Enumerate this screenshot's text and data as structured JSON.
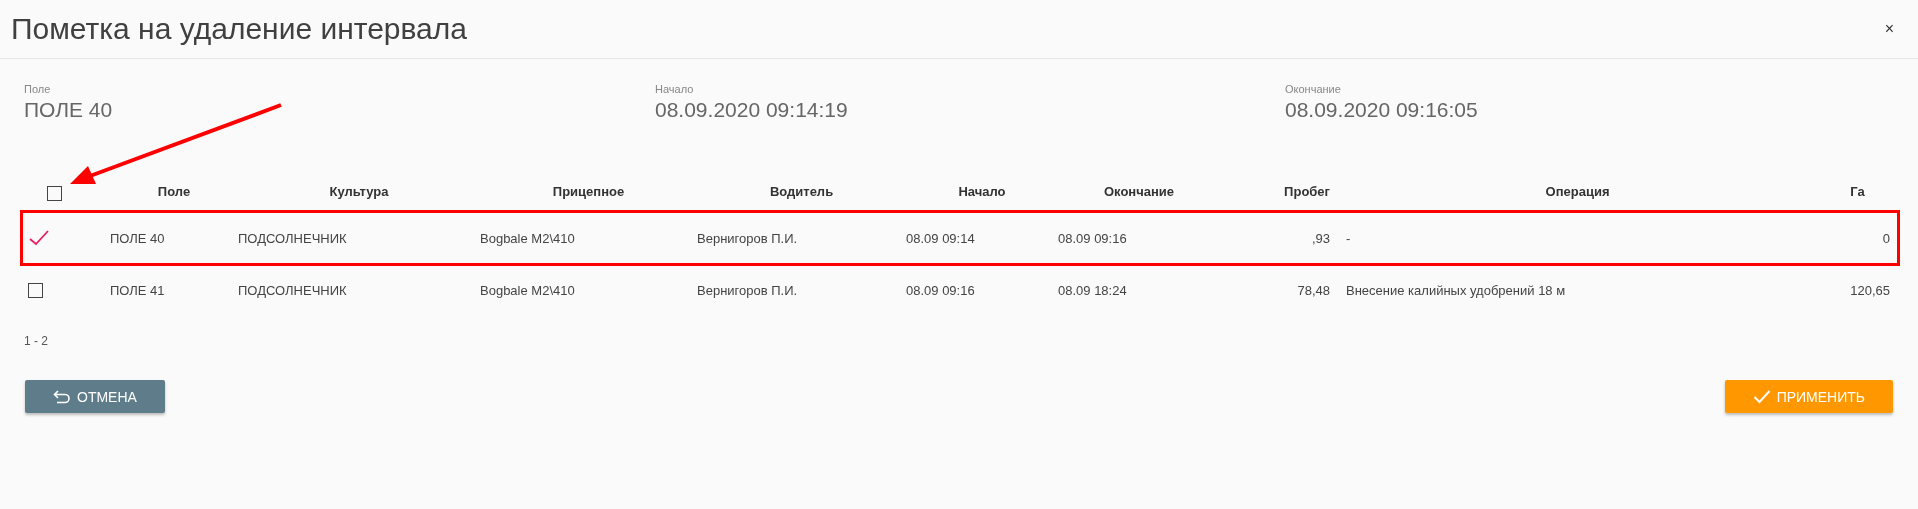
{
  "window": {
    "title": "Пометка на удаление интервала",
    "close": "×"
  },
  "fields": [
    {
      "label": "Поле",
      "value": "ПОЛЕ 40"
    },
    {
      "label": "Начало",
      "value": "08.09.2020 09:14:19"
    },
    {
      "label": "Окончание",
      "value": "08.09.2020 09:16:05"
    }
  ],
  "table": {
    "select_all_checked": false,
    "columns": [
      "Поле",
      "Культура",
      "Прицепное",
      "Водитель",
      "Начало",
      "Окончание",
      "Пробег",
      "Операция",
      "Га"
    ],
    "rows": [
      {
        "checked": true,
        "highlighted": true,
        "cells": [
          "ПОЛЕ 40",
          "ПОДСОЛНЕЧНИК",
          "Bogbale M2\\410",
          "Вернигоров П.И.",
          "08.09 09:14",
          "08.09 09:16",
          ",93",
          "-",
          "0"
        ]
      },
      {
        "checked": false,
        "highlighted": false,
        "cells": [
          "ПОЛЕ 41",
          "ПОДСОЛНЕЧНИК",
          "Bogbale M2\\410",
          "Вернигоров П.И.",
          "08.09 09:16",
          "08.09 18:24",
          "78,48",
          "Внесение калийных удобрений 18 м",
          "120,65"
        ]
      }
    ]
  },
  "pagination": "1 - 2",
  "buttons": [
    {
      "label": "ОТМЕНА",
      "kind": "cancel"
    },
    {
      "label": "ПРИМЕНИТЬ",
      "kind": "apply"
    }
  ]
}
